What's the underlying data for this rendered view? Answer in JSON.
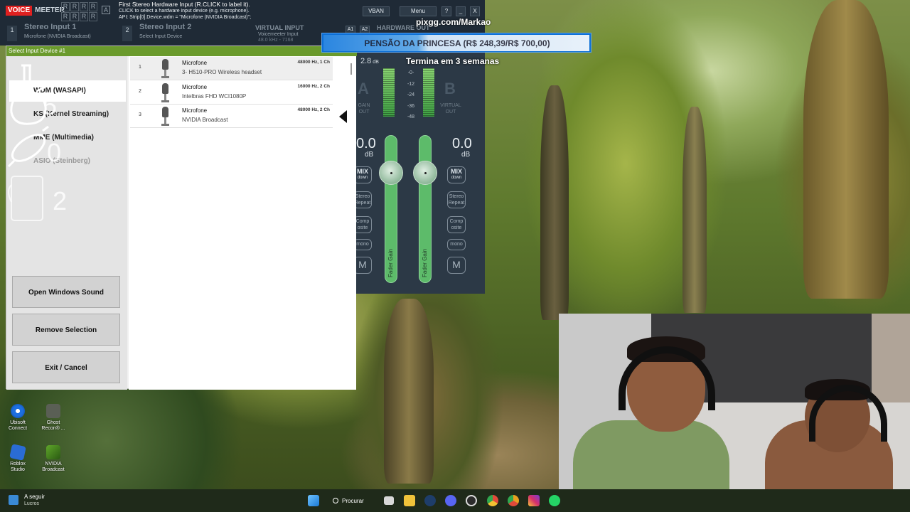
{
  "voicemeeter": {
    "logo_voice": "VOICE",
    "logo_meeter": "MEETER",
    "rrrr": [
      "R",
      "R",
      "R",
      "R",
      "R",
      "R",
      "R",
      "R"
    ],
    "a_label": "A",
    "info_line1": "First Stereo Hardware Input (R.CLICK to label it).",
    "info_line2": "CLICK to select a hardware input device (e.g. microphone).",
    "info_line3": "API: Strip[0].Device.wdm = \"Microfone (NVIDIA Broadcast)\";",
    "vban": "VBAN",
    "menu": "Menu",
    "help": "?",
    "minimize": "_",
    "close": "X",
    "strip1_num": "1",
    "strip1_name": "Stereo Input 1",
    "strip1_dev": "Microfone (NVIDIA Broadcast)",
    "strip2_num": "2",
    "strip2_name": "Stereo Input 2",
    "strip2_dev": "Select Input Device",
    "virtual_name": "VIRTUAL INPUT",
    "virtual_sub": "Voicemeeter Input",
    "virtual_sub2": "48.0 kHz - 7168",
    "a1": "A1",
    "a2": "A2",
    "hardware_out": "HARDWARE OUT"
  },
  "dialog": {
    "title": "Select Input Device #1",
    "drivers": [
      {
        "label": "WDM (WASAPI)",
        "state": "selected"
      },
      {
        "label": "KS (Kernel Streaming)",
        "state": "normal"
      },
      {
        "label": "MME (Multimedia)",
        "state": "normal"
      },
      {
        "label": "ASIO (Steinberg)",
        "state": "disabled"
      }
    ],
    "open_sound": "Open Windows Sound",
    "remove": "Remove Selection",
    "exit": "Exit / Cancel",
    "devices": [
      {
        "index": "1",
        "type": "Microfone",
        "name": "3- H510-PRO Wireless headset",
        "format": "48000 Hz, 1 Ch"
      },
      {
        "index": "2",
        "type": "Microfone",
        "name": "Intelbras FHD WCI1080P",
        "format": "16000 Hz, 2 Ch"
      },
      {
        "index": "3",
        "type": "Microfone",
        "name": "NVIDIA Broadcast",
        "format": "48000 Hz, 2 Ch"
      }
    ]
  },
  "mixer": {
    "level_left": "2.8",
    "level_unit": "dB",
    "scale": [
      "-0-",
      "-12",
      "-24",
      "-36",
      "-48"
    ],
    "A": "A",
    "B": "B",
    "sub_left1": "GAIN",
    "sub_left2": "OUT",
    "sub_right1": "VIRTUAL",
    "sub_right2": "OUT",
    "db_left": "0.0",
    "db_right": "0.0",
    "db_unit": "dB",
    "mix_label": "MIX",
    "mix_sub": "down",
    "stereo_label": "Stereo",
    "stereo_sub": "Repeat",
    "comp_label": "Comp",
    "comp_sub": "osite",
    "mono": "mono",
    "M": "M",
    "fader_label": "Fader Gain"
  },
  "overlay": {
    "pix": "pixgg.com/Markao",
    "goal": "PENSÃO DA PRINCESA (R$ 248,39/R$ 700,00)",
    "goal_progress": 0.355,
    "ends": "Termina em 3 semanas",
    "sticker_a": "5",
    "sticker_b": "0",
    "sticker_c": "2"
  },
  "desktop": [
    {
      "label1": "Ubisoft",
      "label2": "Connect",
      "color": "#1d6fe0"
    },
    {
      "label1": "Ghost",
      "label2": "Recon® ...",
      "color": "#5a5f55"
    },
    {
      "label1": "Roblox",
      "label2": "Studio",
      "color": "#2a6cd4"
    },
    {
      "label1": "NVIDIA",
      "label2": "Broadcast",
      "color": "#5fa62a"
    }
  ],
  "taskbar": {
    "weather_title": "A seguir",
    "weather_sub": "Lucros",
    "search": "Procurar",
    "apps": [
      {
        "name": "start-icon",
        "color": "#3aa0f0"
      },
      {
        "name": "taskview-icon",
        "color": "#d8d8d8"
      },
      {
        "name": "explorer-icon",
        "color": "#f0c23a"
      },
      {
        "name": "steam-icon",
        "color": "#1e3d6a"
      },
      {
        "name": "discord-icon",
        "color": "#5865f2"
      },
      {
        "name": "obs-icon",
        "color": "#2c2c2c"
      },
      {
        "name": "chrome-icon",
        "color": "#e04a3a"
      },
      {
        "name": "chrome-alt-icon",
        "color": "#e8a020"
      },
      {
        "name": "instagram-icon",
        "color": "#d6306a"
      },
      {
        "name": "whatsapp-icon",
        "color": "#25d366"
      },
      {
        "name": "onedrive-icon",
        "color": "#e8a040"
      }
    ]
  }
}
